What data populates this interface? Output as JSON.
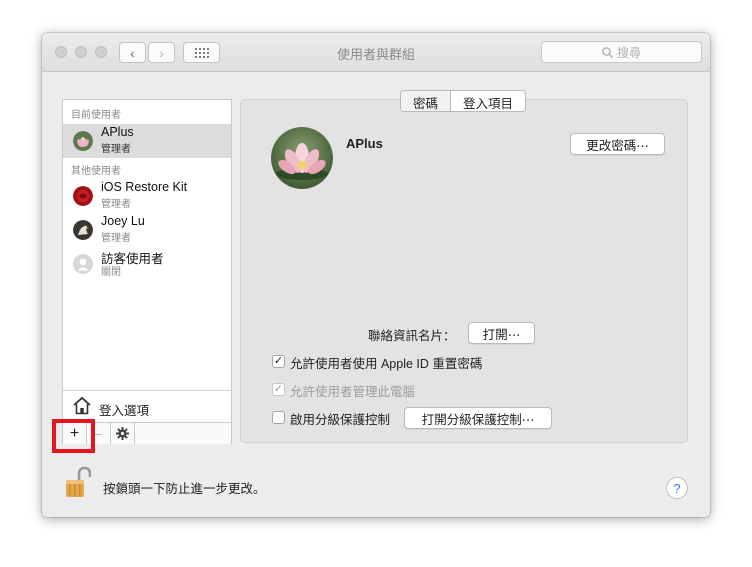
{
  "window": {
    "title": "使用者與群組"
  },
  "search": {
    "placeholder": "搜尋",
    "icon": "search-icon"
  },
  "sidebar": {
    "current_section": "目前使用者",
    "other_section": "其他使用者",
    "users": [
      {
        "name": "APlus",
        "role": "管理者",
        "selected": true
      },
      {
        "name": "iOS Restore Kit",
        "role": "管理者"
      },
      {
        "name": "Joey Lu",
        "role": "管理者"
      },
      {
        "name": "訪客使用者",
        "role": "關閉"
      }
    ],
    "login_options": "登入選項",
    "toolbar": {
      "add": "+",
      "remove": "−"
    }
  },
  "tabs": [
    {
      "label": "密碼",
      "active": true
    },
    {
      "label": "登入項目",
      "active": false
    }
  ],
  "profile": {
    "name": "APlus",
    "change_password": "更改密碼⋯",
    "contact_card_label": "聯絡資訊名片：",
    "open_button": "打開⋯",
    "allow_apple_id": {
      "label": "允許使用者使用 Apple ID 重置密碼",
      "checked": true
    },
    "allow_admin": {
      "label": "允許使用者管理此電腦",
      "checked": true,
      "disabled": true
    },
    "parental": {
      "label": "啟用分級保護控制",
      "checked": false
    },
    "parental_button": "打開分級保護控制⋯"
  },
  "footer": {
    "lock_message": "按鎖頭一下防止進一步更改。",
    "help": "?"
  },
  "colors": {
    "highlight": "#e5161b",
    "help_accent": "#2f7bf5",
    "window_bg": "#ececec"
  }
}
